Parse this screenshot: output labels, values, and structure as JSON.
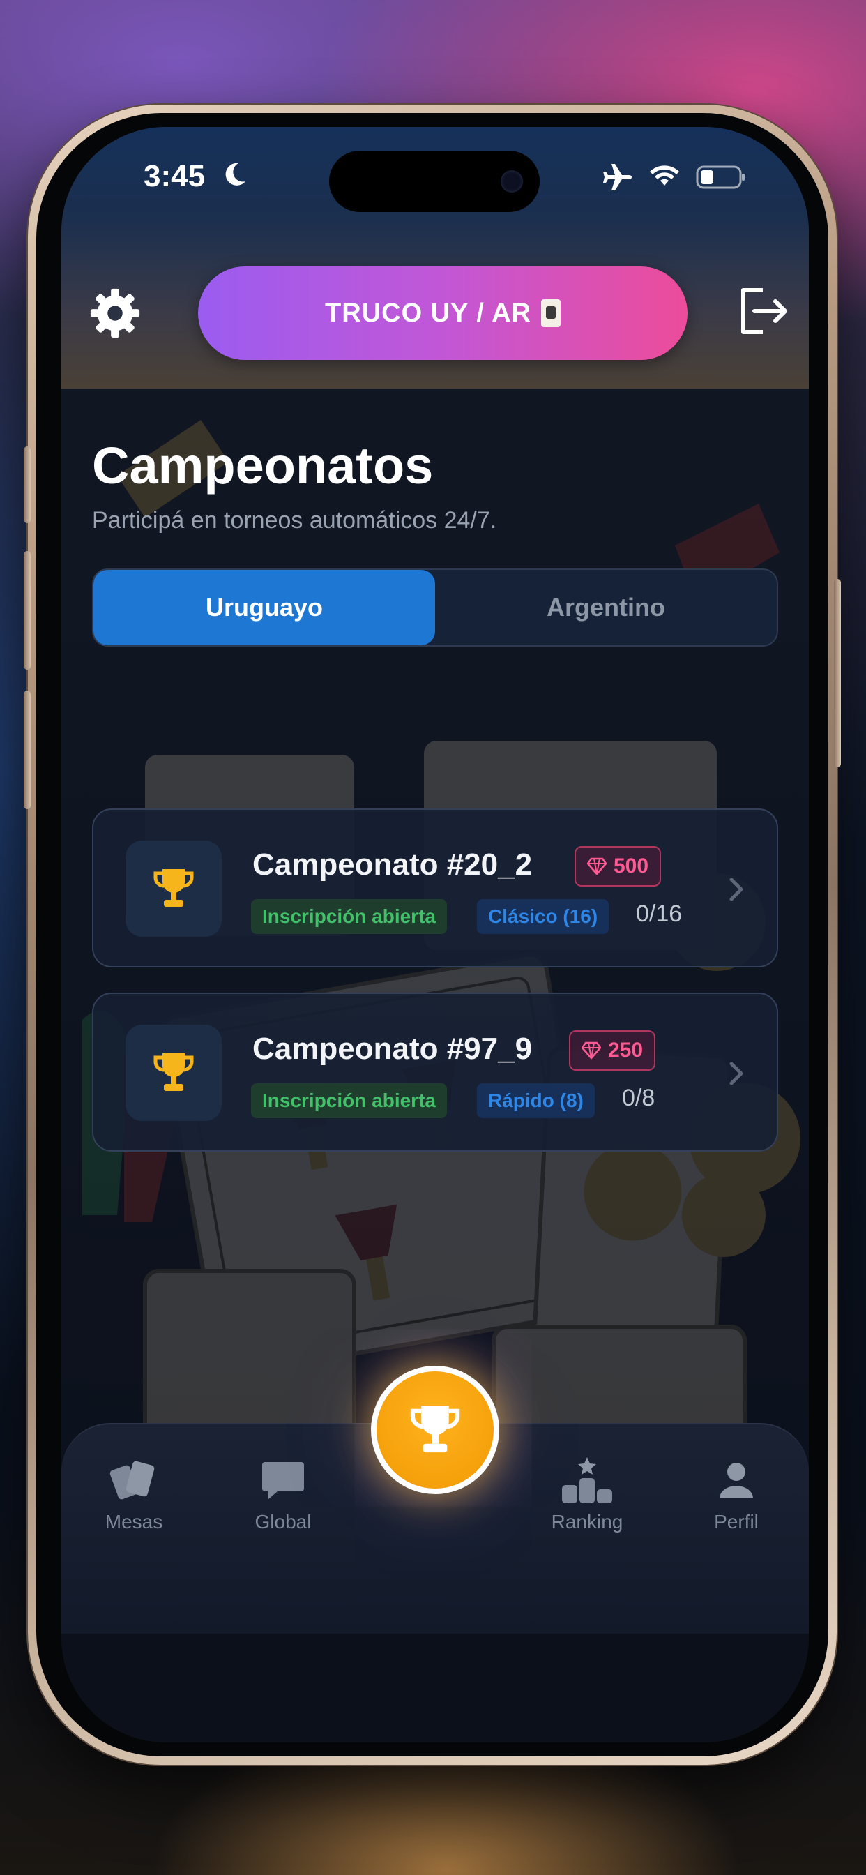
{
  "status_bar": {
    "time": "3:45"
  },
  "header": {
    "title": "TRUCO UY / AR"
  },
  "page": {
    "title": "Campeonatos",
    "subtitle": "Participá en torneos automáticos 24/7."
  },
  "tabs": [
    {
      "label": "Uruguayo",
      "active": true
    },
    {
      "label": "Argentino",
      "active": false
    }
  ],
  "tournaments": [
    {
      "name": "Campeonato #20_2",
      "prize": "500",
      "status": "Inscripción abierta",
      "mode": "Clásico (16)",
      "players": "0/16"
    },
    {
      "name": "Campeonato #97_9",
      "prize": "250",
      "status": "Inscripción abierta",
      "mode": "Rápido (8)",
      "players": "0/8"
    }
  ],
  "nav": {
    "mesas": "Mesas",
    "global": "Global",
    "ranking": "Ranking",
    "perfil": "Perfil"
  },
  "colors": {
    "accent_blue": "#1f77d4",
    "pill_start": "#9b5cf0",
    "pill_end": "#ec4c9a",
    "gold": "#ffb21c",
    "gem_pink": "#ff5a92",
    "chip_green": "#43c06a",
    "chip_blue": "#2e86e6"
  }
}
